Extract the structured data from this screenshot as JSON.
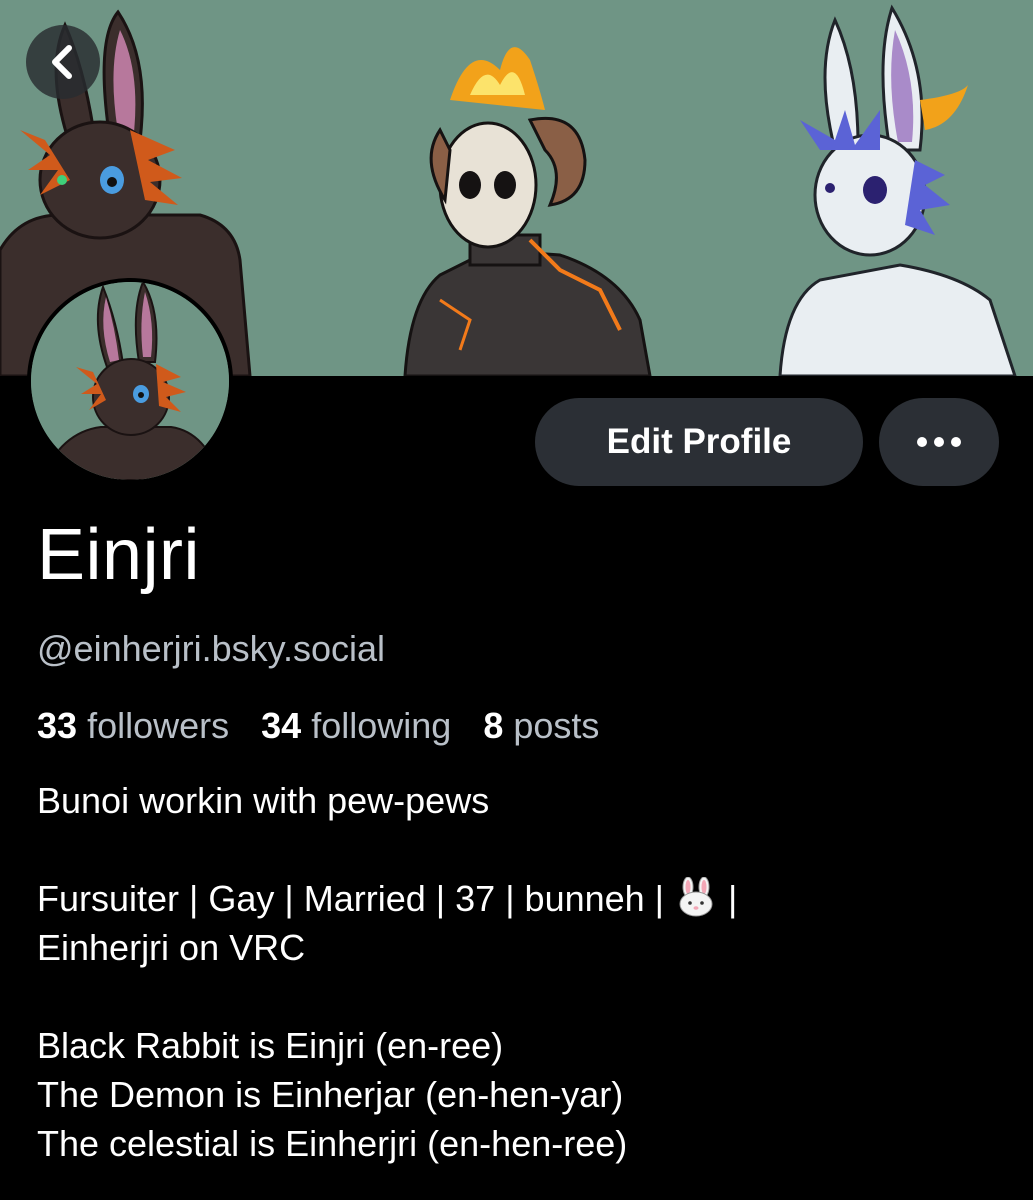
{
  "profile": {
    "display_name": "Einjri",
    "handle": "@einherjri.bsky.social",
    "stats": {
      "followers_count": "33",
      "followers_label": "followers",
      "following_count": "34",
      "following_label": "following",
      "posts_count": "8",
      "posts_label": "posts"
    },
    "bio": {
      "line1": "Bunoi workin with pew-pews",
      "line2a": "Fursuiter | Gay | Married | 37 | bunneh | ",
      "line2b": " |",
      "line3": "Einherjri on VRC",
      "line4": "Black Rabbit is Einjri (en-ree)",
      "line5": "The Demon is Einherjar (en-hen-yar)",
      "line6": "The celestial is Einherjri (en-hen-ree)"
    }
  },
  "actions": {
    "edit_label": "Edit Profile"
  },
  "icons": {
    "back": "chevron-left-icon",
    "more": "ellipsis-icon",
    "bunny_emoji": "rabbit-face-icon"
  },
  "colors": {
    "banner_bg": "#6f9585",
    "button_bg": "#2b2f35",
    "muted_text": "#b9c0c8"
  }
}
